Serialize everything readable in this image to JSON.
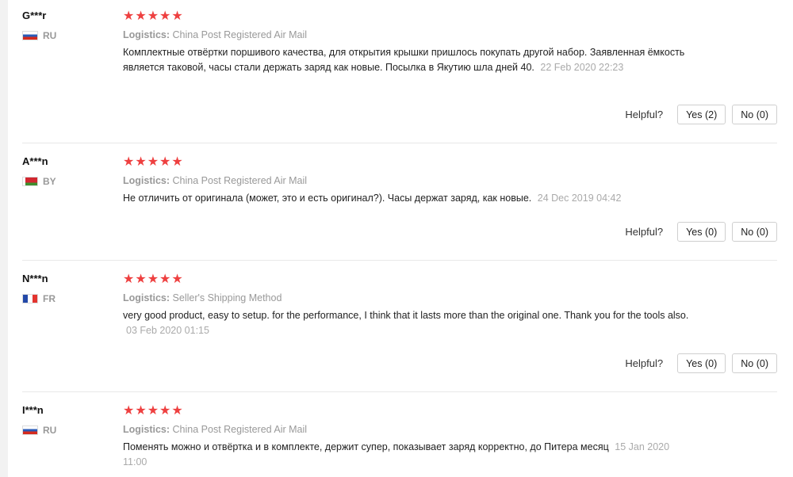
{
  "reviews": [
    {
      "user": "G***r",
      "country": "RU",
      "flag_icon": "russia-flag-icon",
      "stars": "★★★★★",
      "logistics_label": "Logistics:",
      "logistics": "China Post Registered Air Mail",
      "text": "Комплектные отвёртки поршивого качества, для открытия крышки пришлось покупать другой набор. Заявленная ёмкость является таковой, часы стали держать заряд как новые. Посылка в Якутию шла дней 40.",
      "date": "22 Feb 2020 22:23",
      "helpful_label": "Helpful?",
      "yes": "Yes (2)",
      "no": "No (0)"
    },
    {
      "user": "A***n",
      "country": "BY",
      "flag_icon": "belarus-flag-icon",
      "stars": "★★★★★",
      "logistics_label": "Logistics:",
      "logistics": "China Post Registered Air Mail",
      "text": "Не отличить от оригинала (может, это и есть оригинал?). Часы держат заряд, как новые.",
      "date": "24 Dec 2019 04:42",
      "helpful_label": "Helpful?",
      "yes": "Yes (0)",
      "no": "No (0)"
    },
    {
      "user": "N***n",
      "country": "FR",
      "flag_icon": "france-flag-icon",
      "stars": "★★★★★",
      "logistics_label": "Logistics:",
      "logistics": "Seller's Shipping Method",
      "text": "very good product, easy to setup. for the performance, I think that it lasts more than the original one. Thank you for the tools also.",
      "date": "03 Feb 2020 01:15",
      "helpful_label": "Helpful?",
      "yes": "Yes (0)",
      "no": "No (0)"
    },
    {
      "user": "I***n",
      "country": "RU",
      "flag_icon": "russia-flag-icon",
      "stars": "★★★★★",
      "logistics_label": "Logistics:",
      "logistics": "China Post Registered Air Mail",
      "text": "Поменять можно и отвёртка и в комплекте, держит супер, показывает заряд корректно, до Питера месяц",
      "date": "15 Jan 2020 11:00"
    }
  ],
  "colors": {
    "star": "#ee4040",
    "muted": "#999999",
    "border": "#cfcfcf"
  }
}
